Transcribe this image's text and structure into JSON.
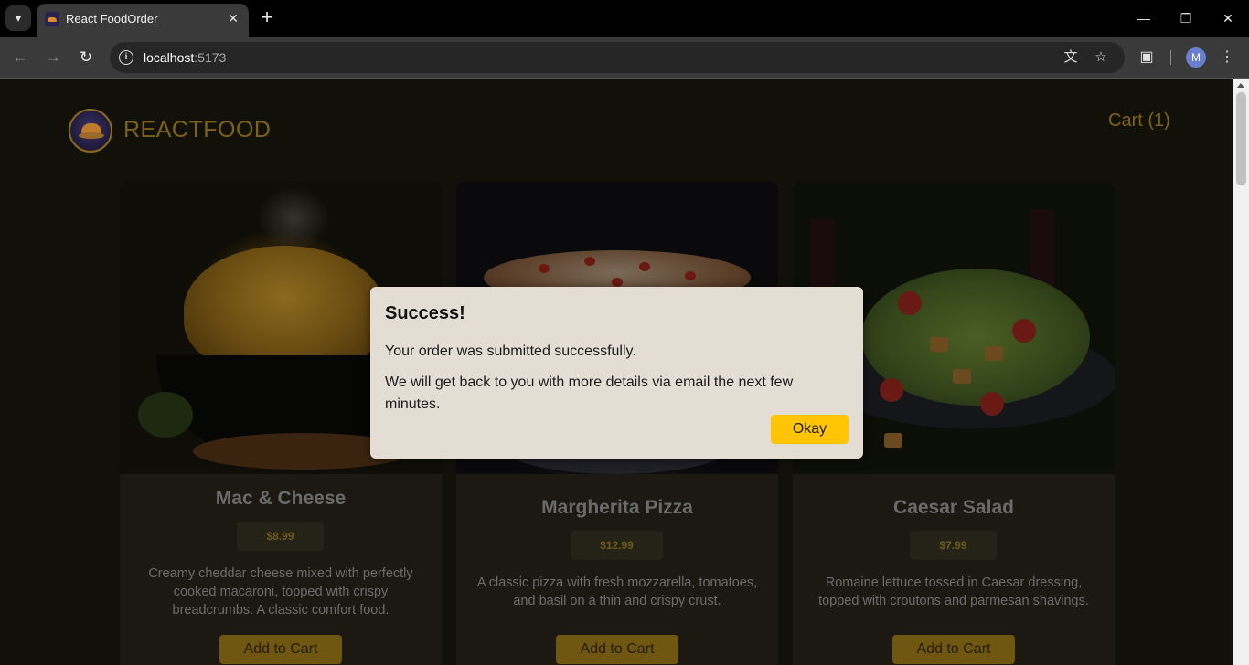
{
  "browser": {
    "tab_title": "React FoodOrder",
    "url_host": "localhost",
    "url_port": ":5173",
    "avatar_letter": "M",
    "icons": {
      "tab_list": "chevron-down-icon",
      "close_tab": "close-icon",
      "new_tab": "plus-icon",
      "back": "back-arrow-icon",
      "forward": "forward-arrow-icon",
      "reload": "reload-icon",
      "site_info": "info-icon",
      "translate": "translate-icon",
      "bookmark": "star-icon",
      "extensions": "puzzle-icon",
      "menu": "kebab-menu-icon"
    }
  },
  "header": {
    "brand": "REACTFOOD",
    "cart_label": "Cart (1)"
  },
  "meals": [
    {
      "name": "Mac & Cheese",
      "price": "$8.99",
      "description": "Creamy cheddar cheese mixed with perfectly cooked macaroni, topped with crispy breadcrumbs. A classic comfort food.",
      "button": "Add to Cart"
    },
    {
      "name": "Margherita Pizza",
      "price": "$12.99",
      "description": "A classic pizza with fresh mozzarella, tomatoes, and basil on a thin and crispy crust.",
      "button": "Add to Cart"
    },
    {
      "name": "Caesar Salad",
      "price": "$7.99",
      "description": "Romaine lettuce tossed in Caesar dressing, topped with croutons and parmesan shavings.",
      "button": "Add to Cart"
    }
  ],
  "modal": {
    "title": "Success!",
    "line1": "Your order was submitted successfully.",
    "line2": "We will get back to you with more details via email the next few minutes.",
    "button": "Okay"
  },
  "colors": {
    "accent": "#ffc404",
    "page_bg": "#121109",
    "modal_bg": "#e4ddd4"
  }
}
